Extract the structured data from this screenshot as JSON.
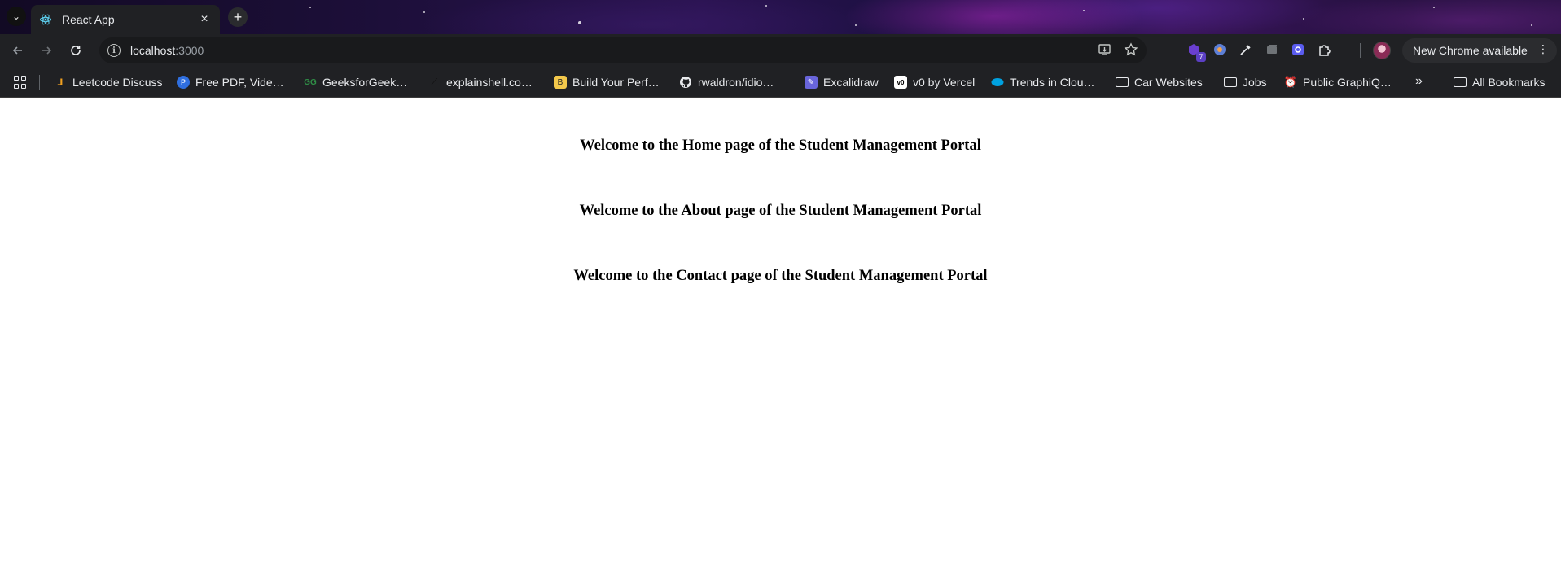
{
  "browser": {
    "tab": {
      "title": "React App",
      "close_label": "×"
    },
    "new_tab_label": "+",
    "tab_list_label": "⌄",
    "address_bar": {
      "host": "localhost",
      "port": ":3000"
    },
    "extensions": {
      "badge_count": "7"
    },
    "update_button_label": "New Chrome available",
    "colors": {
      "chrome_bg": "#202124",
      "omnibox_bg": "#191a1c",
      "text": "#e8eaed"
    }
  },
  "bookmarks": {
    "items": [
      {
        "label": "Leetcode Discuss",
        "icon": "leetcode-icon"
      },
      {
        "label": "Free PDF, Vide…",
        "icon": "free-pdf-icon"
      },
      {
        "label": "GeeksforGeek…",
        "icon": "gfg-icon"
      },
      {
        "label": "explainshell.co…",
        "icon": "explainshell-icon"
      },
      {
        "label": "Build Your Perf…",
        "icon": "build-icon"
      },
      {
        "label": "rwaldron/idio…",
        "icon": "github-icon"
      },
      {
        "label": "Excalidraw",
        "icon": "excalidraw-icon"
      },
      {
        "label": "v0 by Vercel",
        "icon": "v0-icon"
      },
      {
        "label": "Trends in Clou…",
        "icon": "salesforce-icon"
      },
      {
        "label": "Car Websites",
        "icon": "folder-icon"
      },
      {
        "label": "Jobs",
        "icon": "folder-icon"
      },
      {
        "label": "Public GraphiQ…",
        "icon": "graphiql-icon"
      }
    ],
    "overflow_label": "»",
    "all_bookmarks_label": "All Bookmarks"
  },
  "page": {
    "headings": [
      "Welcome to the Home page of the Student Management Portal",
      "Welcome to the About page of the Student Management Portal",
      "Welcome to the Contact page of the Student Management Portal"
    ]
  }
}
